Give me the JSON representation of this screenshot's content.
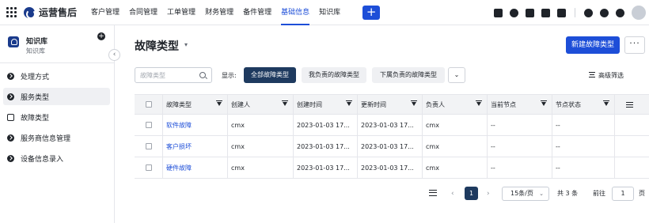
{
  "app": {
    "title": "运营售后"
  },
  "nav": {
    "items": [
      "客户管理",
      "合同管理",
      "工单管理",
      "财务管理",
      "备件管理",
      "基础信息",
      "知识库"
    ],
    "active": "基础信息",
    "add_label": "+"
  },
  "top_icons": [
    "calendar-check-icon",
    "user-icon",
    "document-icon",
    "phone-icon",
    "calendar-icon",
    "bell-icon",
    "help-icon",
    "settings-icon",
    "avatar"
  ],
  "sidebar": {
    "kb_title": "知识库",
    "kb_subtitle": "知识库",
    "collapse_glyph": "‹",
    "items": [
      {
        "label": "处理方式",
        "icon": "check-circle-icon",
        "selected": false
      },
      {
        "label": "服务类型",
        "icon": "arrow-circle-icon",
        "selected": true
      },
      {
        "label": "故障类型",
        "icon": "book-icon",
        "selected": false
      },
      {
        "label": "服务商信息管理",
        "icon": "pin-icon",
        "selected": false
      },
      {
        "label": "设备信息录入",
        "icon": "arrow-circle-icon",
        "selected": false
      }
    ]
  },
  "page": {
    "title": "故障类型",
    "title_caret": "▾",
    "new_button": "新建故障类型",
    "more_button": "···"
  },
  "filters": {
    "search_placeholder": "故障类型",
    "show_label": "显示:",
    "tabs": [
      "全部故障类型",
      "我负责的故障类型",
      "下属负责的故障类型"
    ],
    "active_tab": "全部故障类型",
    "expand_glyph": "⌄",
    "advanced": "高级筛选"
  },
  "table": {
    "columns": [
      "故障类型",
      "创建人",
      "创建时间",
      "更新时间",
      "负责人",
      "当前节点",
      "节点状态"
    ],
    "rows": [
      {
        "type": "软件故障",
        "creator": "cmx",
        "created": "2023-01-03 17...",
        "updated": "2023-01-03 17...",
        "owner": "cmx",
        "node": "--",
        "status": "--"
      },
      {
        "type": "客户损坏",
        "creator": "cmx",
        "created": "2023-01-03 17...",
        "updated": "2023-01-03 17...",
        "owner": "cmx",
        "node": "--",
        "status": "--"
      },
      {
        "type": "硬件故障",
        "creator": "cmx",
        "created": "2023-01-03 17...",
        "updated": "2023-01-03 17...",
        "owner": "cmx",
        "node": "--",
        "status": "--"
      }
    ]
  },
  "pagination": {
    "prev": "‹",
    "next": "›",
    "current_page": "1",
    "page_size": "15条/页",
    "page_size_caret": "⌄",
    "total": "共 3 条",
    "goto_label": "前往",
    "goto_value": "1",
    "page_suffix": "页"
  },
  "colors": {
    "accent": "#1d4ed8",
    "dark_tab": "#1e3a5f",
    "row_selected": "#eff0f3"
  }
}
